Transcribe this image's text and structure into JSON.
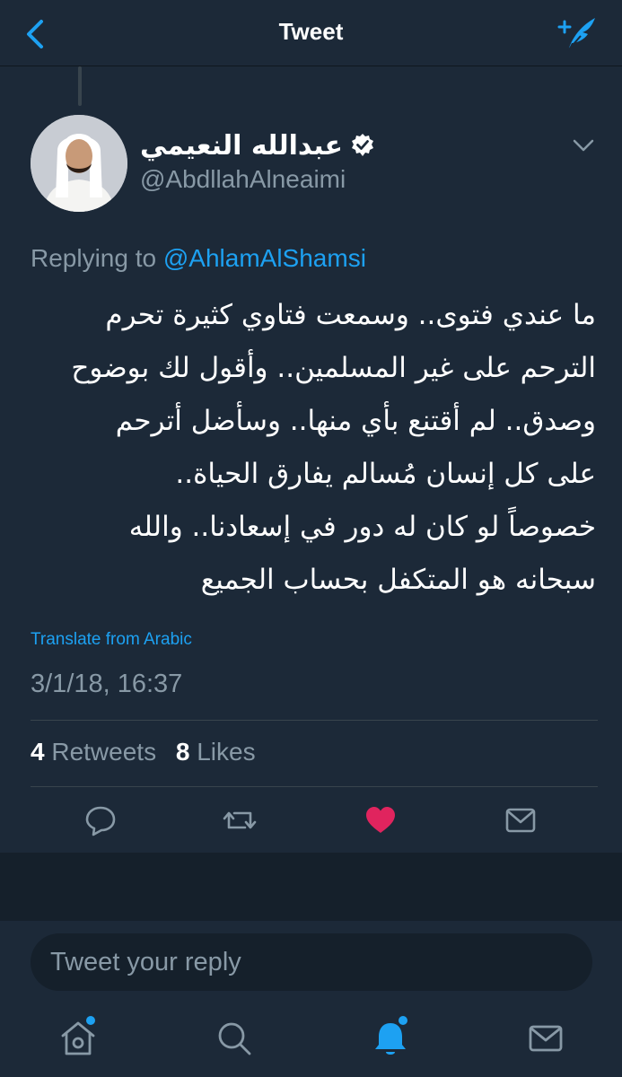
{
  "navbar": {
    "title": "Tweet",
    "back_icon": "chevron-left-icon",
    "compose_icon": "compose-tweet-icon"
  },
  "tweet": {
    "author": {
      "display_name": "عبدالله النعيمي",
      "handle": "@AbdllahAlneaimi",
      "verified": true
    },
    "replying_label": "Replying to",
    "replying_handle": "@AhlamAlShamsi",
    "text": "ما عندي فتوى.. وسمعت فتاوي كثيرة تحرم\nالترحم على غير المسلمين.. وأقول لك بوضوح\nوصدق.. لم أقتنع بأي منها.. وسأضل أترحم\nعلى كل إنسان مُسالم يفارق الحياة..\nخصوصاً لو كان له دور في إسعادنا.. والله\nسبحانه هو المتكفل بحساب الجميع",
    "translate_label": "Translate from Arabic",
    "timestamp": "3/1/18, 16:37",
    "retweets_count": "4",
    "retweets_label": "Retweets",
    "likes_count": "8",
    "likes_label": "Likes"
  },
  "reply": {
    "placeholder": "Tweet your reply"
  },
  "tabs": [
    {
      "name": "home",
      "icon": "home-icon",
      "notification_dot": true
    },
    {
      "name": "search",
      "icon": "search-icon",
      "notification_dot": false
    },
    {
      "name": "notifications",
      "icon": "bell-icon",
      "notification_dot": true,
      "active": true
    },
    {
      "name": "messages",
      "icon": "envelope-icon",
      "notification_dot": false
    }
  ],
  "colors": {
    "accent": "#1da1f2",
    "like": "#e0245e",
    "background": "#15202b",
    "surface": "#1c2938",
    "muted": "#8899a6"
  }
}
